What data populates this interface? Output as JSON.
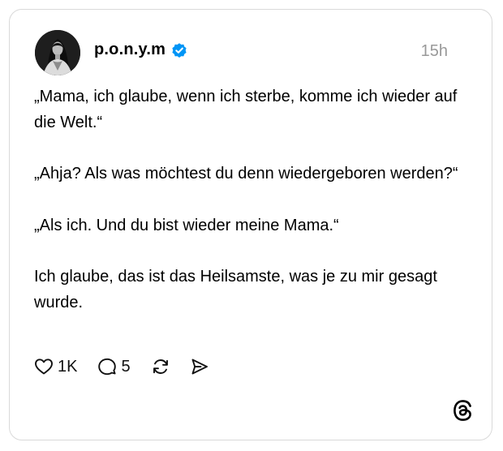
{
  "post": {
    "username": "p.o.n.y.m",
    "timestamp": "15h",
    "paragraphs": [
      "„Mama, ich glaube, wenn ich sterbe, komme ich wieder auf die Welt.“",
      "„Ahja? Als was möchtest du denn wiedergeboren werden?“",
      "„Als ich. Und du bist wieder meine Mama.“",
      "Ich glaube, das ist das Heilsamste, was je zu mir gesagt wurde."
    ]
  },
  "actions": {
    "likes": "1K",
    "replies": "5"
  },
  "icons": {
    "verified": "verified-badge-icon",
    "like": "heart-icon",
    "reply": "speech-bubble-icon",
    "repost": "repost-icon",
    "share": "send-icon",
    "logo": "threads-logo-icon"
  },
  "colors": {
    "verified": "#0095f6",
    "timestamp": "#999999",
    "border": "#d9d9d9"
  }
}
